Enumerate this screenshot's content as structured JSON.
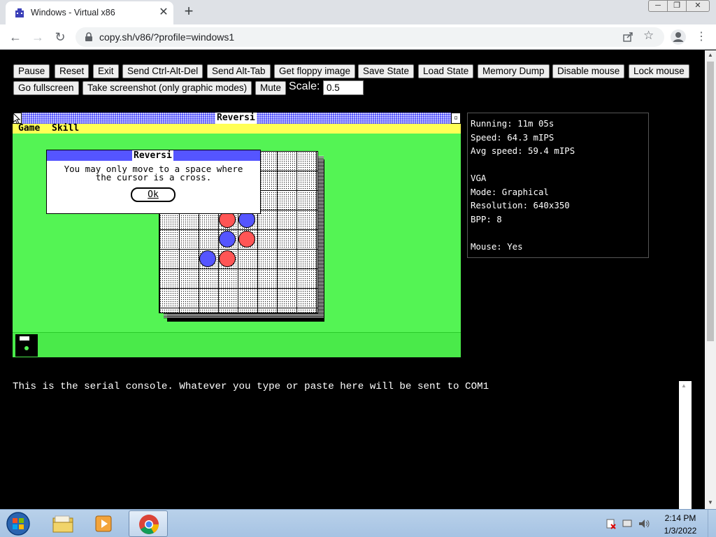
{
  "browser": {
    "tab_title": "Windows - Virtual x86",
    "tab_close": "✕",
    "new_tab": "+",
    "url": "copy.sh/v86/?profile=windows1",
    "window_buttons": {
      "minimize": "─",
      "maximize": "❐",
      "close": "✕"
    }
  },
  "controls": {
    "buttons": [
      "Pause",
      "Reset",
      "Exit",
      "Send Ctrl-Alt-Del",
      "Send Alt-Tab",
      "Get floppy image",
      "Save State",
      "Load State",
      "Memory Dump",
      "Disable mouse",
      "Lock mouse",
      "Go fullscreen",
      "Take screenshot (only graphic modes)",
      "Mute"
    ],
    "scale_label": "Scale:",
    "scale_value": "0.5"
  },
  "emulator": {
    "window_title": "Reversi",
    "menu": [
      "Game",
      "Skill"
    ],
    "dialog": {
      "title": "Reversi",
      "message_line1": "You may only move to a space where",
      "message_line2": "the cursor is a cross.",
      "ok_label": "Ok"
    },
    "colors": {
      "desktop": "#54f454",
      "titlebar": "#5555ff",
      "menubar": "#ffff55",
      "red_disc": "#ff5555",
      "blue_disc": "#5555ff"
    }
  },
  "stats": {
    "running": "Running: 11m 05s",
    "speed": "Speed: 64.3 mIPS",
    "avg_speed": "Avg speed: 59.4 mIPS",
    "vga": "VGA",
    "mode": "Mode: Graphical",
    "resolution": "Resolution: 640x350",
    "bpp": "BPP: 8",
    "mouse": "Mouse: Yes"
  },
  "serial": {
    "text": "This is the serial console. Whatever you type or paste here will be sent to COM1"
  },
  "taskbar": {
    "time": "2:14 PM",
    "date": "1/3/2022",
    "apps": [
      "file-explorer-icon",
      "media-player-icon",
      "chrome-icon"
    ]
  }
}
